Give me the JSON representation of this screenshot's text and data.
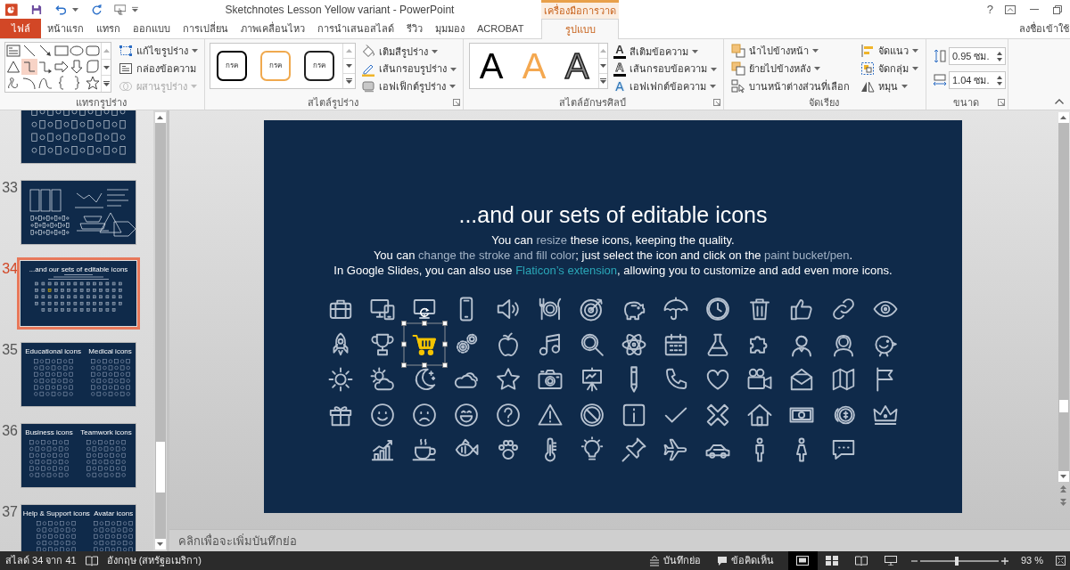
{
  "title_bar": {
    "title": "Sketchnotes Lesson Yellow variant - PowerPoint",
    "context_group": "เครื่องมือการวาด",
    "help": "?"
  },
  "tabs": [
    {
      "label": "ไฟล์",
      "kind": "file",
      "selected": false
    },
    {
      "label": "หน้าแรก",
      "kind": "normal",
      "selected": false
    },
    {
      "label": "แทรก",
      "kind": "normal",
      "selected": false
    },
    {
      "label": "ออกแบบ",
      "kind": "normal",
      "selected": false
    },
    {
      "label": "การเปลี่ยน",
      "kind": "normal",
      "selected": false
    },
    {
      "label": "ภาพเคลื่อนไหว",
      "kind": "normal",
      "selected": false
    },
    {
      "label": "การนำเสนอสไลด์",
      "kind": "normal",
      "selected": false
    },
    {
      "label": "รีวิว",
      "kind": "normal",
      "selected": false
    },
    {
      "label": "มุมมอง",
      "kind": "normal",
      "selected": false
    },
    {
      "label": "ACROBAT",
      "kind": "normal",
      "selected": false
    },
    {
      "label": "รูปแบบ",
      "kind": "context",
      "selected": true
    }
  ],
  "account": "ลงชื่อเข้าใช้",
  "ribbon": {
    "groups": [
      {
        "kind": "insert_shapes",
        "label": "แทรกรูปร่าง",
        "dialog_launcher": false,
        "shapes": [
          {
            "selected": false
          },
          {
            "selected": false
          },
          {
            "selected": false
          },
          {
            "selected": false
          },
          {
            "selected": false
          },
          {
            "selected": false
          },
          {
            "selected": false
          },
          {
            "selected": true
          },
          {
            "selected": false
          },
          {
            "selected": false
          },
          {
            "selected": false
          },
          {
            "selected": false
          },
          {
            "selected": false
          },
          {
            "selected": false
          },
          {
            "selected": false
          },
          {
            "selected": false
          },
          {
            "selected": false
          },
          {
            "selected": false
          }
        ],
        "buttons": [
          {
            "label": "แก้ไขรูปร่าง",
            "dropdown": true,
            "disabled": false
          },
          {
            "label": "กล่องข้อความ",
            "dropdown": false,
            "disabled": false
          },
          {
            "label": "ผสานรูปร่าง",
            "dropdown": true,
            "disabled": true
          }
        ]
      },
      {
        "kind": "shape_styles",
        "label": "สไตล์รูปร่าง",
        "dialog_launcher": true,
        "styles": [
          {
            "text": "กรค",
            "color": "#000000"
          },
          {
            "text": "กรค",
            "color": "#f0a94e"
          },
          {
            "text": "กรค",
            "color": "#202020"
          }
        ],
        "buttons": [
          {
            "label": "เติมสีรูปร่าง",
            "dropdown": true,
            "disabled": false
          },
          {
            "label": "เส้นกรอบรูปร่าง",
            "dropdown": true,
            "disabled": false
          },
          {
            "label": "เอฟเฟ็กต์รูปร่าง",
            "dropdown": true,
            "disabled": false
          }
        ]
      },
      {
        "kind": "wordart_styles",
        "label": "สไตล์อักษรศิลป์",
        "dialog_launcher": true,
        "styles": [
          {
            "text": "A",
            "kind": "solid",
            "color": "#000000"
          },
          {
            "text": "A",
            "kind": "solid",
            "color": "#f4a850"
          },
          {
            "text": "A",
            "kind": "outline",
            "color": "#8c8c8c"
          }
        ],
        "buttons": [
          {
            "icon": "A",
            "label": "สีเติมข้อความ",
            "dropdown": true,
            "disabled": false
          },
          {
            "icon": "A",
            "label": "เส้นกรอบข้อความ",
            "dropdown": true,
            "disabled": false
          },
          {
            "icon": "A",
            "label": "เอฟเฟกต์ข้อความ",
            "dropdown": true,
            "disabled": false
          }
        ]
      },
      {
        "kind": "arrange",
        "label": "จัดเรียง",
        "dialog_launcher": false,
        "buttons": [
          {
            "label": "นำไปข้างหน้า",
            "dropdown": true,
            "disabled": false
          },
          {
            "label": "ย้ายไปข้างหลัง",
            "dropdown": true,
            "disabled": false
          },
          {
            "label": "บานหน้าต่างส่วนที่เลือก",
            "dropdown": false,
            "disabled": false
          },
          {
            "label": "จัดแนว",
            "dropdown": true,
            "disabled": false
          },
          {
            "label": "จัดกลุ่ม",
            "dropdown": true,
            "disabled": false
          },
          {
            "label": "หมุน",
            "dropdown": true,
            "disabled": false
          }
        ]
      },
      {
        "kind": "size",
        "label": "ขนาด",
        "dialog_launcher": true,
        "fields": [
          {
            "kind": "height",
            "value": "0.95 ซม."
          },
          {
            "kind": "width",
            "value": "1.04 ซม."
          }
        ]
      }
    ]
  },
  "slides": [
    {
      "kind": "icons",
      "selected": false
    },
    {
      "number": "33",
      "kind": "infographics",
      "selected": false
    },
    {
      "number": "34",
      "kind": "title",
      "title": "...and our sets of editable icons",
      "selected": true
    },
    {
      "number": "35",
      "kind": "columns",
      "titles": [
        "Educational icons",
        "Medical icons"
      ],
      "selected": false
    },
    {
      "number": "36",
      "kind": "columns",
      "titles": [
        "Business icons",
        "Teamwork icons"
      ],
      "selected": false
    },
    {
      "number": "37",
      "kind": "columns",
      "titles": [
        "Help & Support icons",
        "Avatar icons"
      ],
      "selected": false
    }
  ],
  "slide": {
    "title": "...and our sets of editable icons",
    "lines": [
      {
        "segments": [
          {
            "text": "You can ",
            "kind": "plain"
          },
          {
            "text": "resize",
            "kind": "accent"
          },
          {
            "text": " these icons, keeping the quality.",
            "kind": "plain"
          }
        ]
      },
      {
        "segments": [
          {
            "text": "You can ",
            "kind": "plain"
          },
          {
            "text": "change the stroke and fill color",
            "kind": "accent"
          },
          {
            "text": "; just select the icon and click on the ",
            "kind": "plain"
          },
          {
            "text": "paint bucket/pen",
            "kind": "accent"
          },
          {
            "text": ".",
            "kind": "plain"
          }
        ]
      },
      {
        "segments": [
          {
            "text": "In Google Slides, you can also use ",
            "kind": "plain"
          },
          {
            "text": "Flaticon’s extension",
            "kind": "link"
          },
          {
            "text": ", allowing you to customize and add even more icons.",
            "kind": "plain"
          }
        ]
      }
    ],
    "icon_rows": [
      {
        "icons": [
          {
            "selected": false,
            "color": "#b7c2d0"
          },
          {
            "selected": false,
            "color": "#b7c2d0"
          },
          {
            "selected": false,
            "color": "#b7c2d0"
          },
          {
            "selected": false,
            "color": "#b7c2d0"
          },
          {
            "selected": false,
            "color": "#b7c2d0"
          },
          {
            "selected": false,
            "color": "#b7c2d0"
          },
          {
            "selected": false,
            "color": "#b7c2d0"
          },
          {
            "selected": false,
            "color": "#b7c2d0"
          },
          {
            "selected": false,
            "color": "#b7c2d0"
          },
          {
            "selected": false,
            "color": "#b7c2d0"
          },
          {
            "selected": false,
            "color": "#b7c2d0"
          },
          {
            "selected": false,
            "color": "#b7c2d0"
          },
          {
            "selected": false,
            "color": "#b7c2d0"
          },
          {
            "selected": false,
            "color": "#b7c2d0"
          }
        ]
      },
      {
        "icons": [
          {
            "selected": false,
            "color": "#b7c2d0"
          },
          {
            "selected": false,
            "color": "#b7c2d0"
          },
          {
            "selected": true,
            "color": "#f5c400"
          },
          {
            "selected": false,
            "color": "#b7c2d0"
          },
          {
            "selected": false,
            "color": "#b7c2d0"
          },
          {
            "selected": false,
            "color": "#b7c2d0"
          },
          {
            "selected": false,
            "color": "#b7c2d0"
          },
          {
            "selected": false,
            "color": "#b7c2d0"
          },
          {
            "selected": false,
            "color": "#b7c2d0"
          },
          {
            "selected": false,
            "color": "#b7c2d0"
          },
          {
            "selected": false,
            "color": "#b7c2d0"
          },
          {
            "selected": false,
            "color": "#b7c2d0"
          },
          {
            "selected": false,
            "color": "#b7c2d0"
          },
          {
            "selected": false,
            "color": "#b7c2d0"
          }
        ]
      },
      {
        "icons": [
          {
            "selected": false,
            "color": "#b7c2d0"
          },
          {
            "selected": false,
            "color": "#b7c2d0"
          },
          {
            "selected": false,
            "color": "#b7c2d0"
          },
          {
            "selected": false,
            "color": "#b7c2d0"
          },
          {
            "selected": false,
            "color": "#b7c2d0"
          },
          {
            "selected": false,
            "color": "#b7c2d0"
          },
          {
            "selected": false,
            "color": "#b7c2d0"
          },
          {
            "selected": false,
            "color": "#b7c2d0"
          },
          {
            "selected": false,
            "color": "#b7c2d0"
          },
          {
            "selected": false,
            "color": "#b7c2d0"
          },
          {
            "selected": false,
            "color": "#b7c2d0"
          },
          {
            "selected": false,
            "color": "#b7c2d0"
          },
          {
            "selected": false,
            "color": "#b7c2d0"
          },
          {
            "selected": false,
            "color": "#b7c2d0"
          }
        ]
      },
      {
        "icons": [
          {
            "selected": false,
            "color": "#b7c2d0"
          },
          {
            "selected": false,
            "color": "#b7c2d0"
          },
          {
            "selected": false,
            "color": "#b7c2d0"
          },
          {
            "selected": false,
            "color": "#b7c2d0"
          },
          {
            "selected": false,
            "color": "#b7c2d0"
          },
          {
            "selected": false,
            "color": "#b7c2d0"
          },
          {
            "selected": false,
            "color": "#b7c2d0"
          },
          {
            "selected": false,
            "color": "#b7c2d0"
          },
          {
            "selected": false,
            "color": "#b7c2d0"
          },
          {
            "selected": false,
            "color": "#b7c2d0"
          },
          {
            "selected": false,
            "color": "#b7c2d0"
          },
          {
            "selected": false,
            "color": "#b7c2d0"
          },
          {
            "selected": false,
            "color": "#b7c2d0"
          },
          {
            "selected": false,
            "color": "#b7c2d0"
          }
        ]
      },
      {
        "icons": [
          {
            "selected": false,
            "color": "#b7c2d0"
          },
          {
            "selected": false,
            "color": "#b7c2d0"
          },
          {
            "selected": false,
            "color": "#b7c2d0"
          },
          {
            "selected": false,
            "color": "#b7c2d0"
          },
          {
            "selected": false,
            "color": "#b7c2d0"
          },
          {
            "selected": false,
            "color": "#b7c2d0"
          },
          {
            "selected": false,
            "color": "#b7c2d0"
          },
          {
            "selected": false,
            "color": "#b7c2d0"
          },
          {
            "selected": false,
            "color": "#b7c2d0"
          },
          {
            "selected": false,
            "color": "#b7c2d0"
          },
          {
            "selected": false,
            "color": "#b7c2d0"
          },
          {
            "selected": false,
            "color": "#b7c2d0"
          }
        ]
      }
    ]
  },
  "notes": {
    "placeholder": "คลิกเพื่อจะเพิ่มบันทึกย่อ"
  },
  "status_bar": {
    "slide_counter": "สไลด์ 34 จาก 41",
    "language": "อังกฤษ (สหรัฐอเมริกา)",
    "buttons": [
      {
        "label": "บันทึกย่อ"
      },
      {
        "label": "ข้อคิดเห็น"
      }
    ],
    "views": [
      {
        "selected": true
      },
      {
        "selected": false
      },
      {
        "selected": false
      },
      {
        "selected": false
      }
    ],
    "zoom": {
      "level": 0.47,
      "reading": "93 %"
    }
  }
}
